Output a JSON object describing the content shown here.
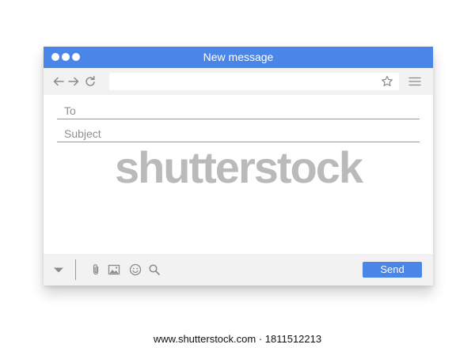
{
  "window": {
    "title": "New message"
  },
  "navbar": {
    "back_icon": "arrow-left-icon",
    "forward_icon": "arrow-right-icon",
    "reload_icon": "reload-icon",
    "address_value": "",
    "bookmark_icon": "star-icon",
    "menu_icon": "hamburger-menu-icon"
  },
  "compose": {
    "to_placeholder": "To",
    "subject_placeholder": "Subject",
    "body_value": ""
  },
  "toolbar": {
    "dropdown_icon": "caret-down-icon",
    "attach_icon": "paperclip-icon",
    "image_icon": "image-icon",
    "emoji_icon": "smiley-icon",
    "search_icon": "search-icon",
    "send_label": "Send"
  },
  "watermark": {
    "text": "shutterstock"
  },
  "footer": {
    "text": "www.shutterstock.com · 1811512213"
  },
  "colors": {
    "accent": "#4a86e8",
    "toolbar_bg": "#f2f2f2",
    "icon_gray": "#8a8a8a"
  }
}
